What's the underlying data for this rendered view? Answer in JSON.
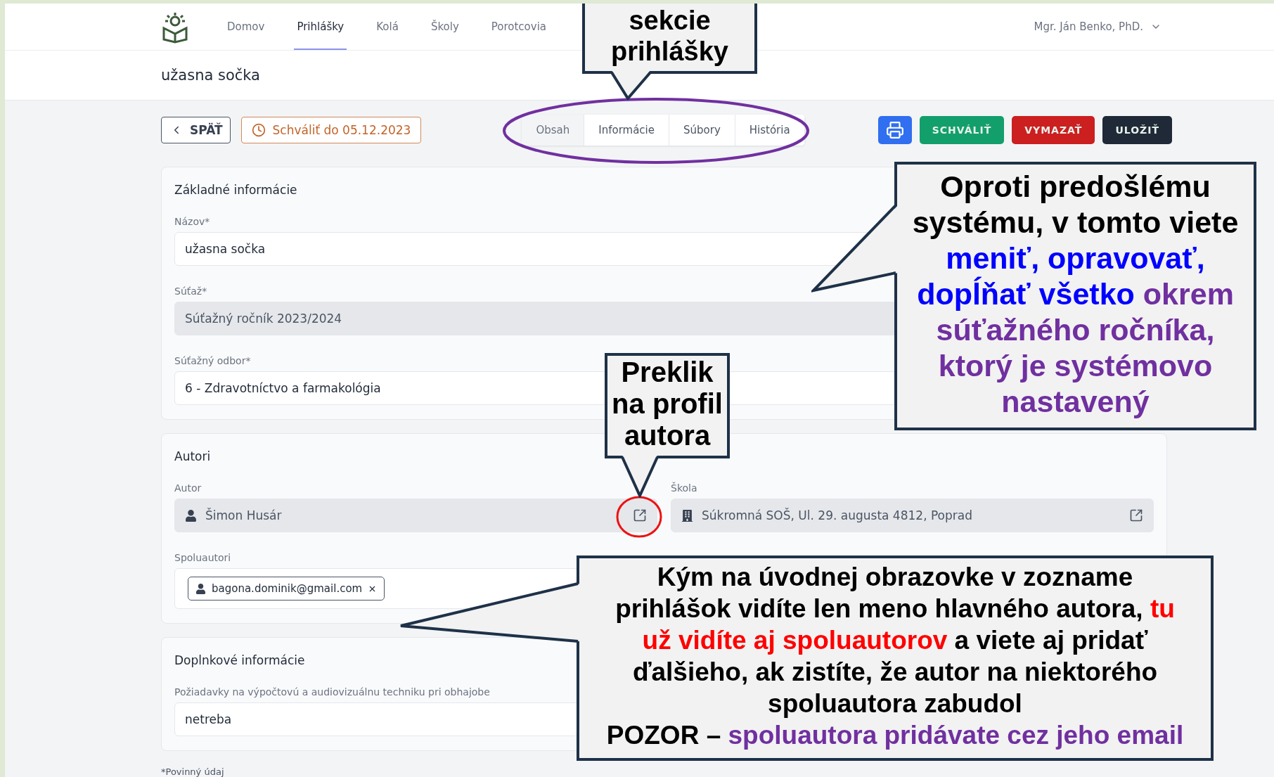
{
  "nav": {
    "items": [
      {
        "label": "Domov",
        "selected": false
      },
      {
        "label": "Prihlášky",
        "selected": true
      },
      {
        "label": "Kolá",
        "selected": false
      },
      {
        "label": "Školy",
        "selected": false
      },
      {
        "label": "Porotcovia",
        "selected": false
      }
    ],
    "user": "Mgr. Ján Benko, PhD."
  },
  "page_title": "užasna sočka",
  "toolbar": {
    "back": "SPÄŤ",
    "deadline": "Schváliť do 05.12.2023",
    "tabs": [
      {
        "label": "Obsah",
        "selected": true
      },
      {
        "label": "Informácie",
        "selected": false
      },
      {
        "label": "Súbory",
        "selected": false
      },
      {
        "label": "História",
        "selected": false
      }
    ],
    "actions": [
      {
        "kind": "print"
      },
      {
        "kind": "approve",
        "label": "SCHVÁLIŤ"
      },
      {
        "kind": "delete",
        "label": "VYMAZAŤ"
      },
      {
        "kind": "save",
        "label": "ULOŽIŤ"
      }
    ]
  },
  "basic_info": {
    "title": "Základné informácie",
    "fields": [
      {
        "label": "Názov*",
        "value": "užasna sočka",
        "disabled": false
      },
      {
        "label": "Súťaž*",
        "value": "Súťažný ročník 2023/2024",
        "disabled": true
      },
      {
        "label": "Súťažný odbor*",
        "value": "6 - Zdravotníctvo a farmakológia",
        "disabled": false
      }
    ]
  },
  "authors": {
    "title": "Autori",
    "author": {
      "label": "Autor",
      "value": "Šimon Husár"
    },
    "school": {
      "label": "Škola",
      "value": "Súkromná SOŠ, Ul. 29. augusta 4812, Poprad"
    },
    "coauthors": {
      "label": "Spoluautori",
      "tags": [
        "bagona.dominik@gmail.com"
      ]
    }
  },
  "additional_info": {
    "title": "Doplnkové informácie",
    "fields": [
      {
        "label": "Požiadavky na výpočtovú a audiovizuálnu techniku pri obhajobe",
        "value": "netreba",
        "disabled": false
      }
    ]
  },
  "footnote": "*Povinný údaj",
  "annotations": [
    {
      "paragraphs": [
        [
          {
            "text": "sekcie prihlášky",
            "color": "#000000"
          }
        ]
      ]
    },
    {
      "paragraphs": [
        [
          {
            "text": "Preklik na profil autora",
            "color": "#000000"
          }
        ]
      ]
    },
    {
      "paragraphs": [
        [
          {
            "text": "Oproti predošlému systému, v tomto viete ",
            "color": "#000000"
          },
          {
            "text": "meniť, opravovať, dopĺňať všetko ",
            "color": "#0000ff"
          },
          {
            "text": "okrem súťažného ročníka, ktorý je systémovo nastavený",
            "color": "#7030a0"
          }
        ]
      ]
    },
    {
      "paragraphs": [
        [
          {
            "text": "Kým na úvodnej obrazovke v zozname prihlášok vidíte len meno hlavného autora, ",
            "color": "#000000"
          },
          {
            "text": "tu už vidíte aj spoluautorov",
            "color": "#ff0000"
          },
          {
            "text": " a viete aj pridať ďalšieho, ak zistíte, že autor na niektorého spoluautora zabudol",
            "color": "#000000"
          }
        ],
        [
          {
            "text": "POZOR – ",
            "color": "#000000"
          },
          {
            "text": "spoluautora pridávate cez jeho email",
            "color": "#7030a0"
          }
        ]
      ]
    }
  ]
}
